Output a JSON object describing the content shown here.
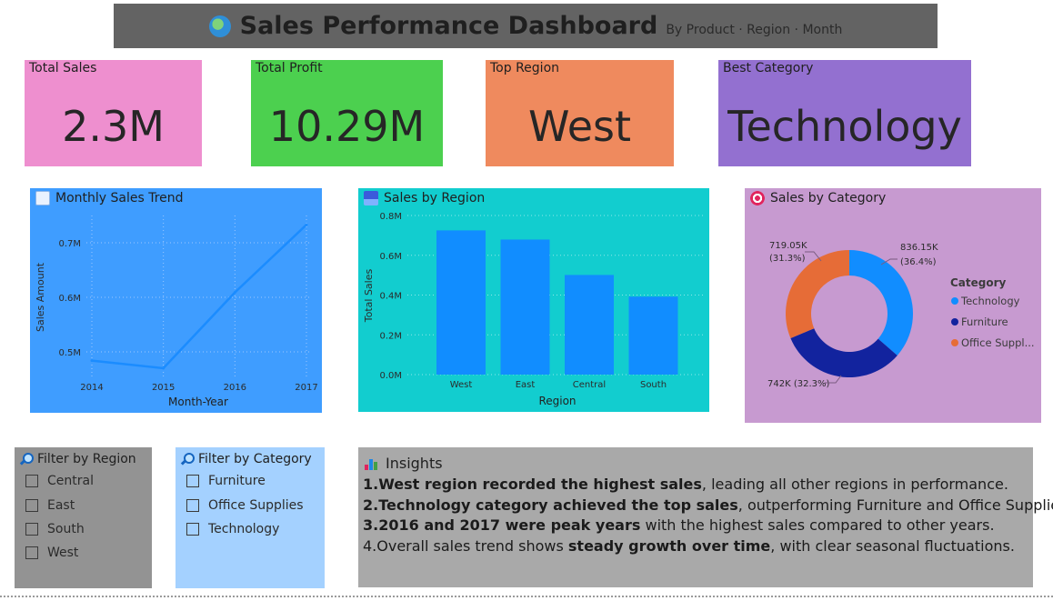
{
  "header": {
    "title": "Sales Performance Dashboard",
    "subtitle": "By Product · Region · Month"
  },
  "kpis": [
    {
      "label": "Total Sales",
      "value": "2.3M",
      "color": "#ee8fcf"
    },
    {
      "label": "Total Profit",
      "value": "10.29M",
      "color": "#4cd04f"
    },
    {
      "label": "Top Region",
      "value": "West",
      "color": "#ef8a5e"
    },
    {
      "label": "Best Category",
      "value": "Technology",
      "color": "#9370d0"
    }
  ],
  "colors": {
    "trend_bg": "#3f9dff",
    "region_bg": "#12cdcf",
    "category_bg": "#c79ad0",
    "bar": "#118dff",
    "tech": "#118dff",
    "furniture": "#12239e",
    "office": "#e66c37"
  },
  "chart_data": [
    {
      "type": "line",
      "title": "Monthly Sales Trend",
      "xlabel": "Month-Year",
      "ylabel": "Sales Amount",
      "x": [
        "2014",
        "2015",
        "2016",
        "2017"
      ],
      "values": [
        484000,
        470000,
        609000,
        733000
      ],
      "yticks": [
        "0.5M",
        "0.6M",
        "0.7M"
      ],
      "ylim": [
        450000,
        750000
      ],
      "grid": true
    },
    {
      "type": "bar",
      "title": "Sales by Region",
      "xlabel": "Region",
      "ylabel": "Total Sales",
      "categories": [
        "West",
        "East",
        "Central",
        "South"
      ],
      "values": [
        725000,
        679000,
        501000,
        392000
      ],
      "yticks": [
        "0.0M",
        "0.2M",
        "0.4M",
        "0.6M",
        "0.8M"
      ],
      "ylim": [
        0,
        800000
      ],
      "grid": true
    },
    {
      "type": "pie",
      "title": "Sales by Category",
      "legend_title": "Category",
      "legend_position": "right",
      "slices": [
        {
          "name": "Technology",
          "legend": "Technology",
          "value": 836150,
          "label": "836.15K",
          "pct": "(36.4%)"
        },
        {
          "name": "Furniture",
          "legend": "Furniture",
          "value": 742000,
          "label": "742K (32.3%)",
          "pct": ""
        },
        {
          "name": "Office Supplies",
          "legend": "Office Suppl...",
          "value": 719050,
          "label": "719.05K",
          "pct": "(31.3%)"
        }
      ]
    }
  ],
  "filters": {
    "region": {
      "title": "Filter by Region",
      "options": [
        "Central",
        "East",
        "South",
        "West"
      ]
    },
    "category": {
      "title": "Filter by Category",
      "options": [
        "Furniture",
        "Office Supplies",
        "Technology"
      ]
    }
  },
  "insights": {
    "title": "Insights",
    "lines": [
      {
        "prefix": "1.",
        "bold": "West region recorded the highest sales",
        "rest": ", leading all other regions in performance."
      },
      {
        "prefix": "2.",
        "bold": "Technology category achieved the top sales",
        "rest": ", outperforming Furniture and Office Supplies."
      },
      {
        "prefix": "3.",
        "bold": "2016 and 2017 were peak years",
        "rest": " with the highest sales compared to other years."
      },
      {
        "pre": "4.Overall sales trend shows ",
        "bold": "steady growth over time",
        "rest": ", with clear seasonal fluctuations."
      }
    ]
  }
}
